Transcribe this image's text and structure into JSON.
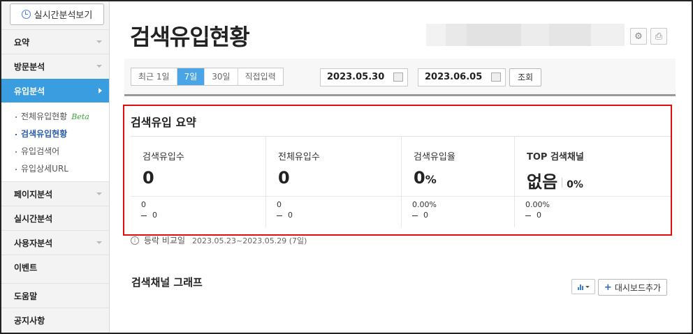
{
  "sidebar": {
    "realtime_button": "실시간분석보기",
    "menu": [
      {
        "label": "요약"
      },
      {
        "label": "방문분석"
      },
      {
        "label": "유입분석"
      },
      {
        "label": "페이지분석"
      },
      {
        "label": "실시간분석"
      },
      {
        "label": "사용자분석"
      },
      {
        "label": "이벤트"
      },
      {
        "label": "도움말"
      },
      {
        "label": "공지사항"
      }
    ],
    "submenu": [
      {
        "label": "전체유입현황",
        "badge": "Beta"
      },
      {
        "label": "검색유입현황"
      },
      {
        "label": "유입검색어"
      },
      {
        "label": "유입상세URL"
      }
    ]
  },
  "header": {
    "title": "검색유입현황"
  },
  "filter": {
    "periods": [
      "최근 1일",
      "7일",
      "30일",
      "직접입력"
    ],
    "selected_period": "7일",
    "start_date": "2023.05.30",
    "separator": "-",
    "end_date": "2023.06.05",
    "query_button": "조회"
  },
  "summary": {
    "title": "검색유입 요약",
    "columns": [
      {
        "label": "검색유입수",
        "value": "0",
        "unit": "",
        "prev": "0",
        "diff": "0"
      },
      {
        "label": "전체유입수",
        "value": "0",
        "unit": "",
        "prev": "0",
        "diff": "0"
      },
      {
        "label": "검색유입율",
        "value": "0",
        "unit": "%",
        "prev": "0.00%",
        "diff": "0"
      },
      {
        "label": "TOP 검색채널",
        "value": "없음",
        "unit": "0%",
        "prev": "0.00%",
        "diff": "0"
      }
    ]
  },
  "compare_note": {
    "label": "등락 비교일",
    "range": "2023.05.23~2023.05.29 (7일)"
  },
  "graph": {
    "title": "검색채널 그래프",
    "dashboard_add_button": "대시보드추가"
  },
  "colors": {
    "active_menu": "#3a9de0",
    "selected_period": "#4aa5e6",
    "highlight_border": "#e20d0d",
    "beta_badge": "#3aa838"
  }
}
